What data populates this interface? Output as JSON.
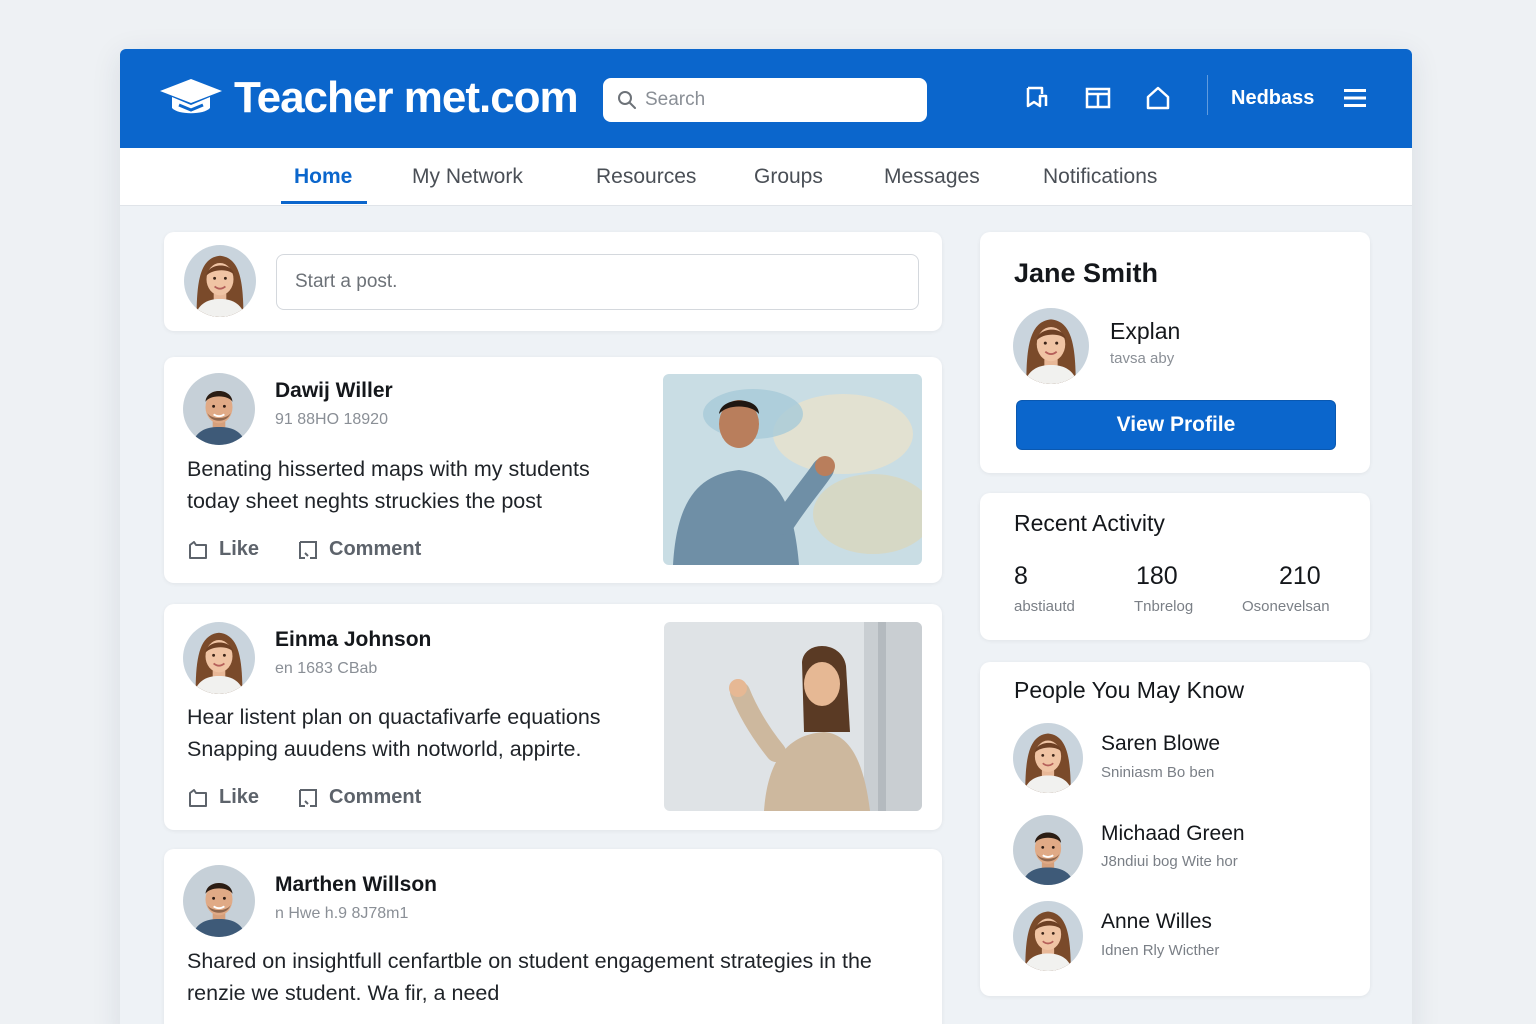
{
  "brand": {
    "name": "Teacher met.com",
    "primary_color": "#0b66cc"
  },
  "header": {
    "search_placeholder": "Search",
    "username": "Nedbass",
    "icons": [
      "bookmark-icon",
      "layout-icon",
      "home-icon",
      "menu-icon"
    ]
  },
  "nav": {
    "tabs": [
      {
        "label": "Home",
        "active": true
      },
      {
        "label": "My Network"
      },
      {
        "label": "Resources"
      },
      {
        "label": "Groups"
      },
      {
        "label": "Messages"
      },
      {
        "label": "Notifications"
      }
    ]
  },
  "composer": {
    "placeholder": "Start a post."
  },
  "feed": {
    "like_label": "Like",
    "comment_label": "Comment",
    "posts": [
      {
        "author": "Dawij Willer",
        "meta": "91 88HO 18920",
        "text": "Benating hisserted maps with my students today sheet neghts struckies the post"
      },
      {
        "author": "Einma Johnson",
        "meta": "en 1683 CBab",
        "text": "Hear listent plan on quactafivarfe equations Snapping auudens with notworld, appirte."
      },
      {
        "author": "Marthen Willson",
        "meta": "n Hwe h.9 8J78m1",
        "text": "Shared on insightfull cenfartble on student engagement strategies in the renzie we student. Wa fir, a need"
      }
    ]
  },
  "profile": {
    "name": "Jane Smith",
    "role": "Explan",
    "sub": "tavsa aby",
    "button": "View Profile"
  },
  "activity": {
    "title": "Recent Activity",
    "stats": [
      {
        "value": "8",
        "label": "abstiautd"
      },
      {
        "value": "180",
        "label": "Tnbrelog"
      },
      {
        "value": "210",
        "label": "Osonevelsan"
      }
    ]
  },
  "people": {
    "title": "People You May Know",
    "items": [
      {
        "name": "Saren Blowe",
        "meta": "Sniniasm Bo ben"
      },
      {
        "name": "Michaad Green",
        "meta": "J8ndiui bog   Wite hor"
      },
      {
        "name": "Anne Willes",
        "meta": "Idnen Rly   Wicther"
      }
    ]
  }
}
